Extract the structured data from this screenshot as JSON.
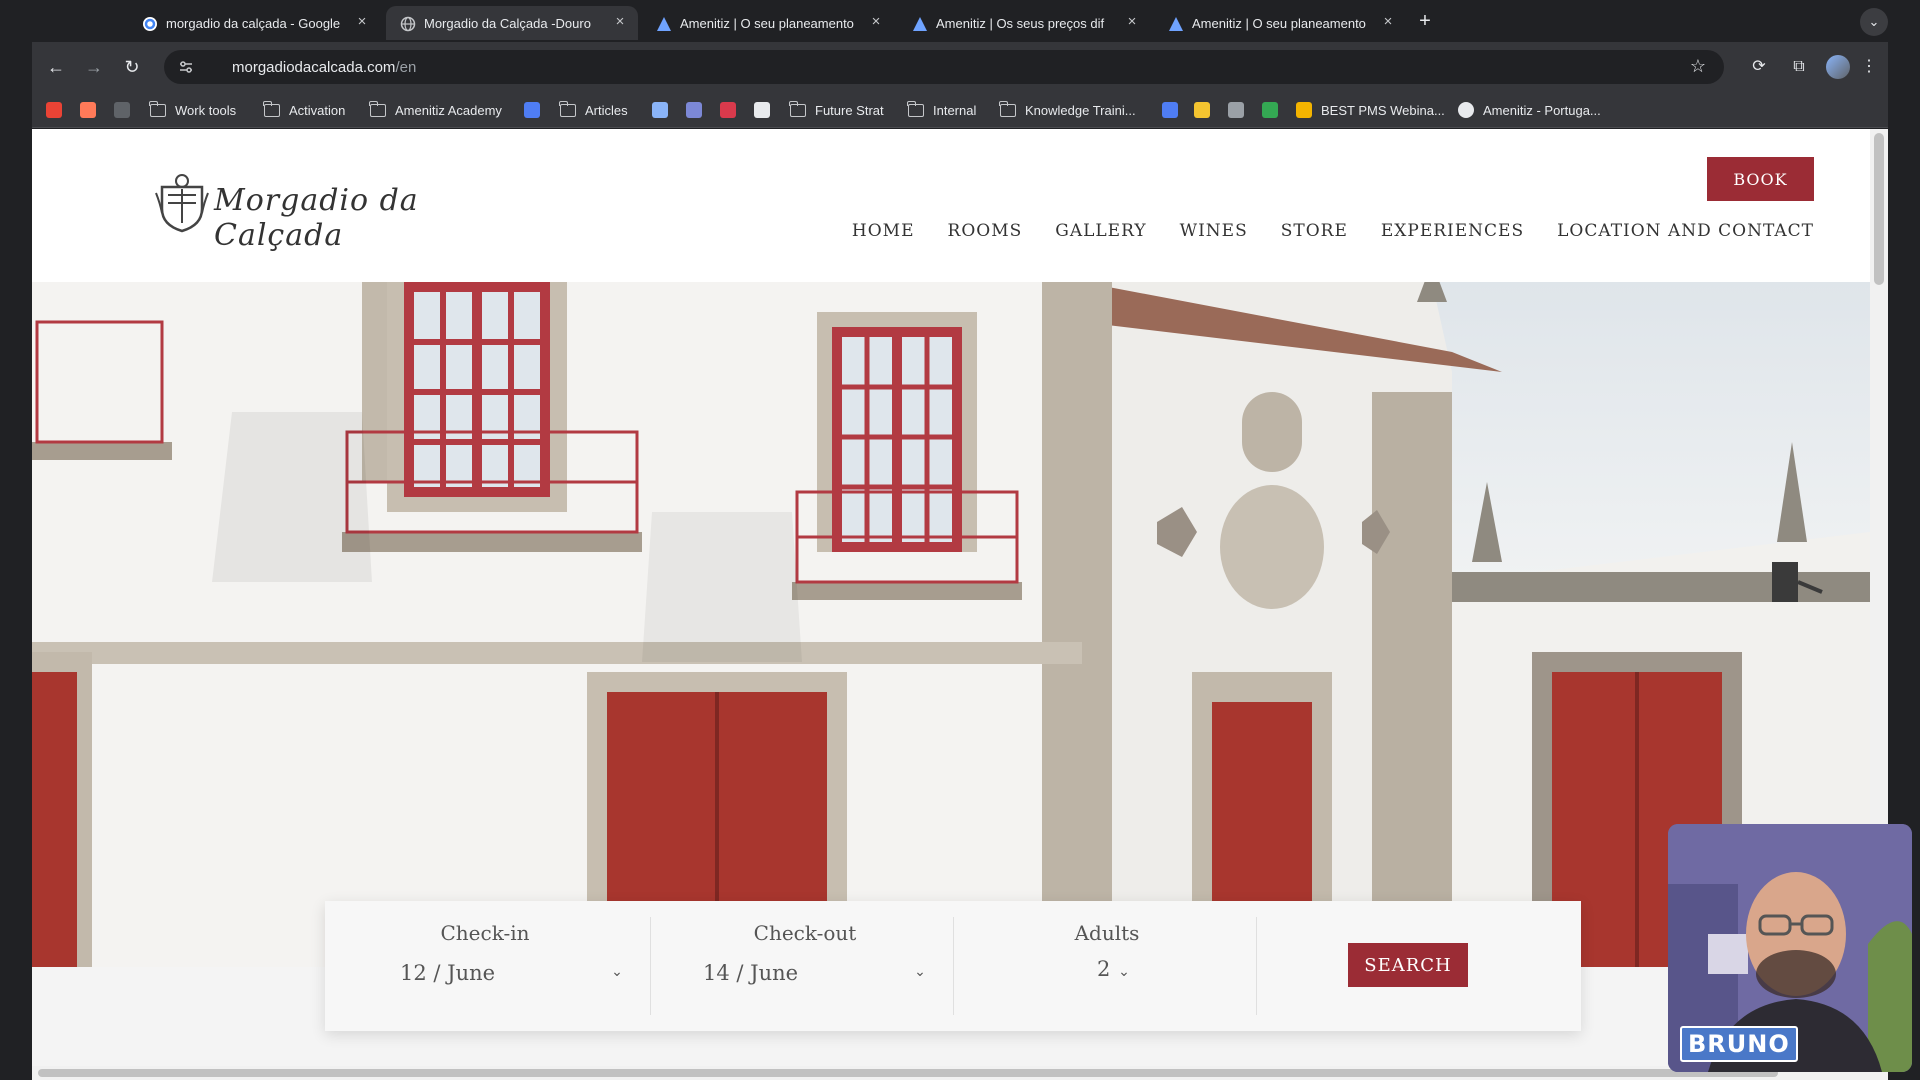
{
  "browser": {
    "tabs": [
      {
        "title": "morgadio da calçada - Google",
        "active": false
      },
      {
        "title": "Morgadio da Calçada -Douro",
        "active": true
      },
      {
        "title": "Amenitiz | O seu planeamento",
        "active": false
      },
      {
        "title": "Amenitiz | Os seus preços dif",
        "active": false
      },
      {
        "title": "Amenitiz | O seu planeamento",
        "active": false
      }
    ],
    "url_host": "morgadiodacalcada.com",
    "url_path": "/en",
    "bookmarks": [
      {
        "label": "Work tools"
      },
      {
        "label": "Activation"
      },
      {
        "label": "Amenitiz Academy"
      },
      {
        "label": "Articles"
      },
      {
        "label": "Future Strat"
      },
      {
        "label": "Internal"
      },
      {
        "label": "Knowledge Traini..."
      },
      {
        "label": "BEST PMS Webina..."
      },
      {
        "label": "Amenitiz - Portuga..."
      }
    ]
  },
  "site": {
    "logo_text": "Morgadio da Calçada",
    "book_label": "BOOK",
    "nav": [
      "HOME",
      "ROOMS",
      "GALLERY",
      "WINES",
      "STORE",
      "EXPERIENCES",
      "LOCATION AND CONTACT"
    ],
    "accent_color": "#9b2c35"
  },
  "booking": {
    "checkin_label": "Check-in",
    "checkin_value": "12 / June",
    "checkout_label": "Check-out",
    "checkout_value": "14 / June",
    "adults_label": "Adults",
    "adults_value": "2",
    "search_label": "SEARCH"
  },
  "webcam": {
    "name": "BRUNO"
  }
}
